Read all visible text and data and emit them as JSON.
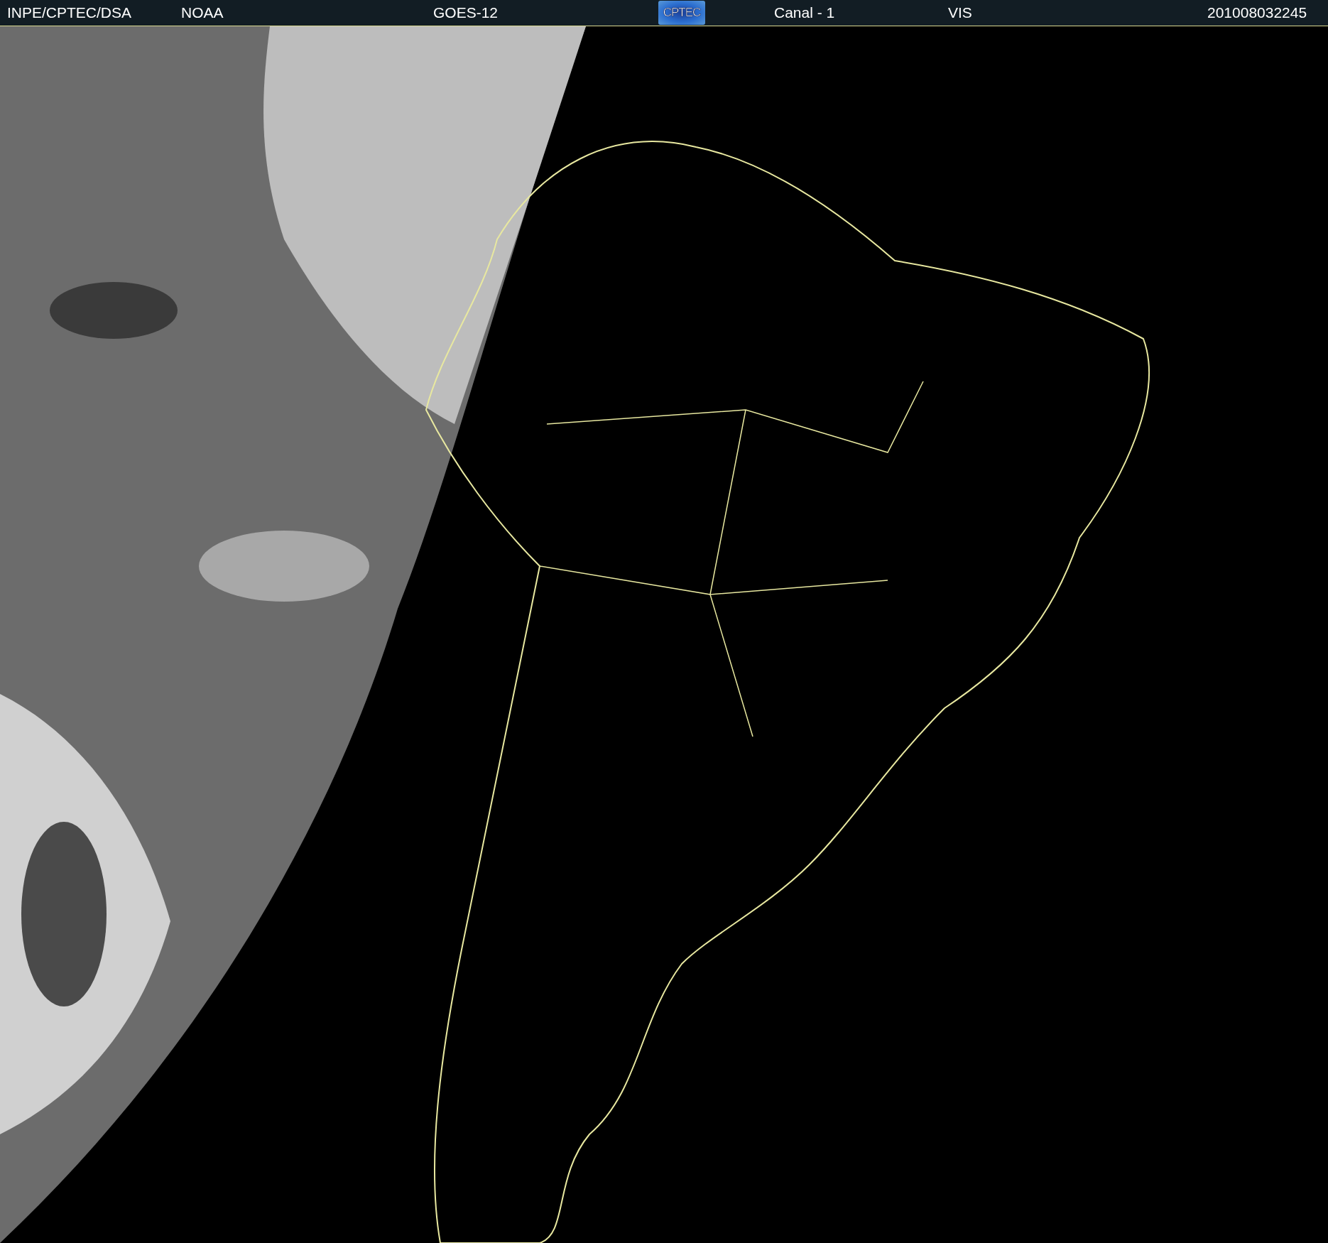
{
  "header": {
    "source": "INPE/CPTEC/DSA",
    "agency": "NOAA",
    "satellite": "GOES-12",
    "logo": "CPTEC",
    "channel": "Canal - 1",
    "band": "VIS",
    "timestamp": "201008032245"
  }
}
